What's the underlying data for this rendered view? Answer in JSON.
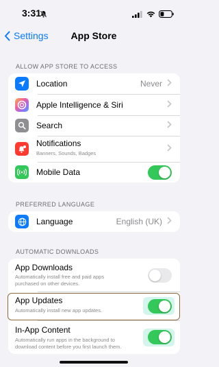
{
  "status": {
    "time": "3:31"
  },
  "nav": {
    "back_label": "Settings",
    "title": "App Store"
  },
  "sections": {
    "access_header": "ALLOW APP STORE TO ACCESS",
    "language_header": "PREFERRED LANGUAGE",
    "downloads_header": "AUTOMATIC DOWNLOADS"
  },
  "access_items": [
    {
      "label": "Location",
      "value": "Never",
      "icon": "location-arrow-icon",
      "color": "#0a7aff"
    },
    {
      "label": "Apple Intelligence & Siri",
      "icon": "siri-icon"
    },
    {
      "label": "Search",
      "icon": "search-icon",
      "color": "#8e8e93"
    },
    {
      "label": "Notifications",
      "sublabel": "Banners, Sounds, Badges",
      "icon": "bell-badge-icon",
      "color": "#ff3b30"
    },
    {
      "label": "Mobile Data",
      "icon": "antenna-icon",
      "color": "#34c759",
      "toggle": true
    }
  ],
  "language": {
    "label": "Language",
    "value": "English (UK)",
    "icon": "globe-icon",
    "color": "#0a7aff"
  },
  "downloads": [
    {
      "label": "App Downloads",
      "sublabel": "Automatically install free and paid apps",
      "sublabel2": "purchased on other devices.",
      "toggle": false
    },
    {
      "label": "App Updates",
      "sublabel": "Automatically install new app updates.",
      "toggle": true
    },
    {
      "label": "In-App Content",
      "sublabel": "Automatically run apps in the background to",
      "sublabel2": "download content before you first launch them.",
      "toggle": true
    }
  ]
}
